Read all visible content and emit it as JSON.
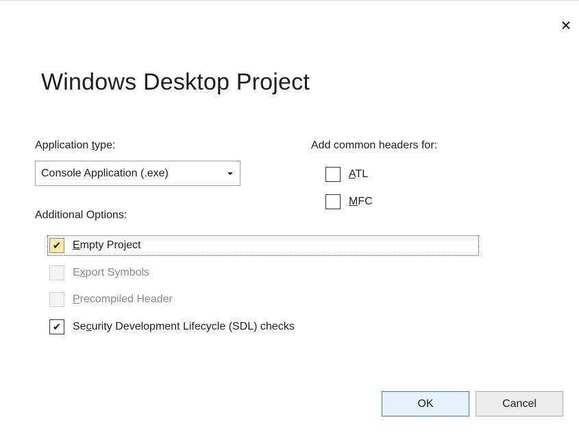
{
  "dialog": {
    "title": "Windows Desktop Project",
    "close_icon": "close-icon"
  },
  "application_type": {
    "label_pre": "Application ",
    "label_accel": "t",
    "label_post": "ype:",
    "selected": "Console Application (.exe)"
  },
  "common_headers": {
    "label": "Add common headers for:",
    "items": [
      {
        "accel": "A",
        "rest": "TL",
        "checked": false
      },
      {
        "accel": "M",
        "rest": "FC",
        "checked": false
      }
    ]
  },
  "additional_options": {
    "label": "Additional Options:",
    "items": [
      {
        "pre": "",
        "accel": "E",
        "rest": "mpty Project",
        "checked": true,
        "enabled": true,
        "focused": true
      },
      {
        "pre": "E",
        "accel": "x",
        "rest": "port Symbols",
        "checked": false,
        "enabled": false,
        "focused": false
      },
      {
        "pre": "",
        "accel": "P",
        "rest": "recompiled Header",
        "checked": false,
        "enabled": false,
        "focused": false
      },
      {
        "pre": "Se",
        "accel": "c",
        "rest": "urity Development Lifecycle (SDL) checks",
        "checked": true,
        "enabled": true,
        "focused": false
      }
    ]
  },
  "buttons": {
    "ok": "OK",
    "cancel": "Cancel"
  },
  "check_glyph": "✔"
}
